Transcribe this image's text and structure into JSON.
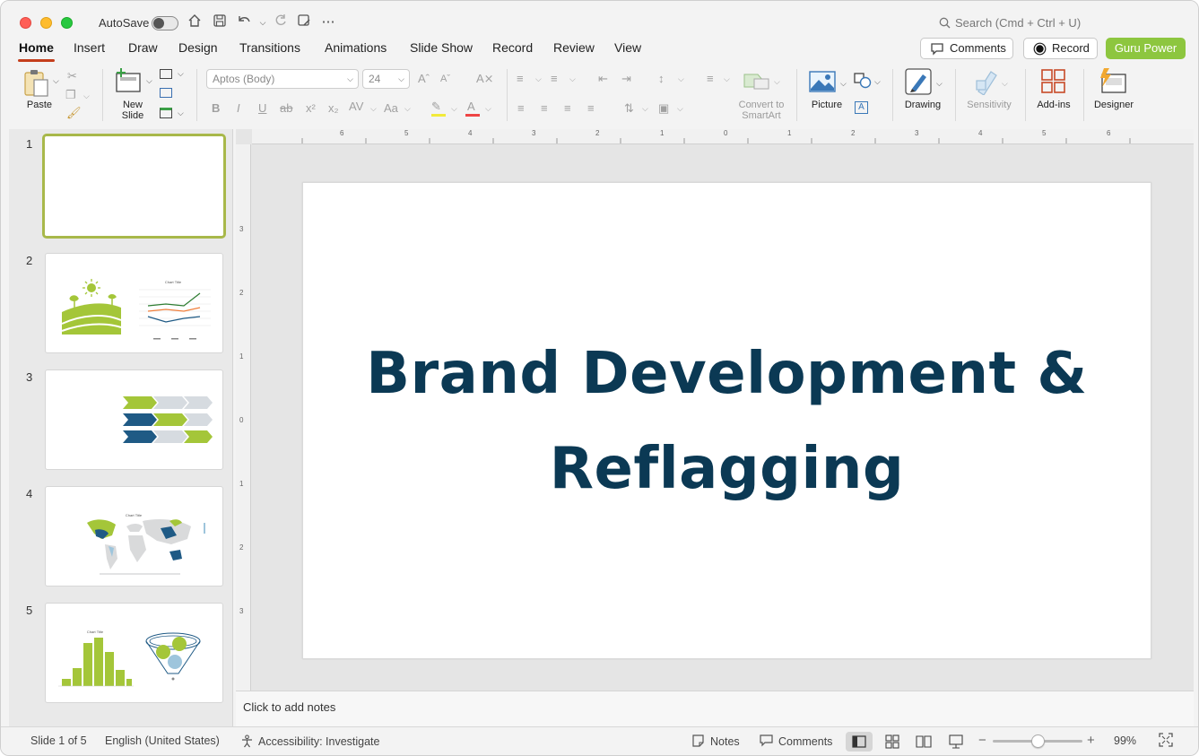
{
  "titlebar": {
    "autosave_label": "AutoSave",
    "search_placeholder": "Search (Cmd + Ctrl + U)",
    "icons": [
      "home-icon",
      "save-icon",
      "undo-icon",
      "redo-icon",
      "save-as-icon",
      "more-icon"
    ]
  },
  "tabs": [
    "Home",
    "Insert",
    "Draw",
    "Design",
    "Transitions",
    "Animations",
    "Slide Show",
    "Record",
    "Review",
    "View"
  ],
  "active_tab": "Home",
  "header_buttons": {
    "comments": "Comments",
    "record": "Record",
    "guru": "Guru Power"
  },
  "ribbon": {
    "paste": "Paste",
    "new_slide_line1": "New",
    "new_slide_line2": "Slide",
    "font_name": "Aptos (Body)",
    "font_size": "24",
    "convert_line1": "Convert to",
    "convert_line2": "SmartArt",
    "picture": "Picture",
    "drawing": "Drawing",
    "sensitivity": "Sensitivity",
    "addins": "Add-ins",
    "designer": "Designer"
  },
  "thumbnails": [
    {
      "number": "1",
      "selected": true
    },
    {
      "number": "2",
      "selected": false
    },
    {
      "number": "3",
      "selected": false
    },
    {
      "number": "4",
      "selected": false
    },
    {
      "number": "5",
      "selected": false
    }
  ],
  "slide": {
    "title_line1": "Brand Development &",
    "title_line2": "Reflagging",
    "title_color": "#0b3954"
  },
  "ruler": {
    "horizontal": [
      "6",
      "5",
      "4",
      "3",
      "2",
      "1",
      "0",
      "1",
      "2",
      "3",
      "4",
      "5",
      "6"
    ],
    "vertical": [
      "3",
      "2",
      "1",
      "0",
      "1",
      "2",
      "3"
    ]
  },
  "notes_placeholder": "Click to add notes",
  "status": {
    "slide_count": "Slide 1 of 5",
    "language": "English (United States)",
    "accessibility": "Accessibility: Investigate",
    "notes": "Notes",
    "comments": "Comments",
    "zoom": "99%",
    "zoom_level": 0.5
  },
  "colors": {
    "accent": "#c43e1c",
    "guru": "#8dc63f",
    "thumb_green": "#a4c639",
    "thumb_blue": "#1f5a85"
  }
}
